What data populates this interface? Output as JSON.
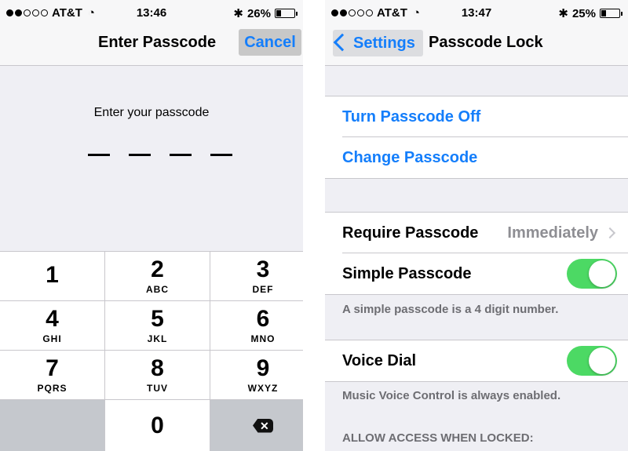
{
  "left": {
    "status": {
      "carrier": "AT&T",
      "time": "13:46",
      "battery": "26%",
      "battery_level": 0.26
    },
    "nav": {
      "title": "Enter Passcode",
      "cancel_label": "Cancel"
    },
    "prompt": "Enter your passcode",
    "keys": [
      {
        "num": "1",
        "letters": ""
      },
      {
        "num": "2",
        "letters": "ABC"
      },
      {
        "num": "3",
        "letters": "DEF"
      },
      {
        "num": "4",
        "letters": "GHI"
      },
      {
        "num": "5",
        "letters": "JKL"
      },
      {
        "num": "6",
        "letters": "MNO"
      },
      {
        "num": "7",
        "letters": "PQRS"
      },
      {
        "num": "8",
        "letters": "TUV"
      },
      {
        "num": "9",
        "letters": "WXYZ"
      },
      {
        "num": "0",
        "letters": ""
      }
    ]
  },
  "right": {
    "status": {
      "carrier": "AT&T",
      "time": "13:47",
      "battery": "25%",
      "battery_level": 0.25
    },
    "nav": {
      "back_label": "Settings",
      "title": "Passcode Lock"
    },
    "items": {
      "turn_off": "Turn Passcode Off",
      "change": "Change Passcode",
      "require": "Require Passcode",
      "require_value": "Immediately",
      "simple": "Simple Passcode",
      "simple_note": "A simple passcode is a 4 digit number.",
      "voice": "Voice Dial",
      "voice_note": "Music Voice Control is always enabled.",
      "allow_header": "ALLOW ACCESS WHEN LOCKED:"
    },
    "toggles": {
      "simple_on": true,
      "voice_on": true
    }
  },
  "colors": {
    "accent": "#147efb",
    "toggle_on": "#4cd964"
  }
}
